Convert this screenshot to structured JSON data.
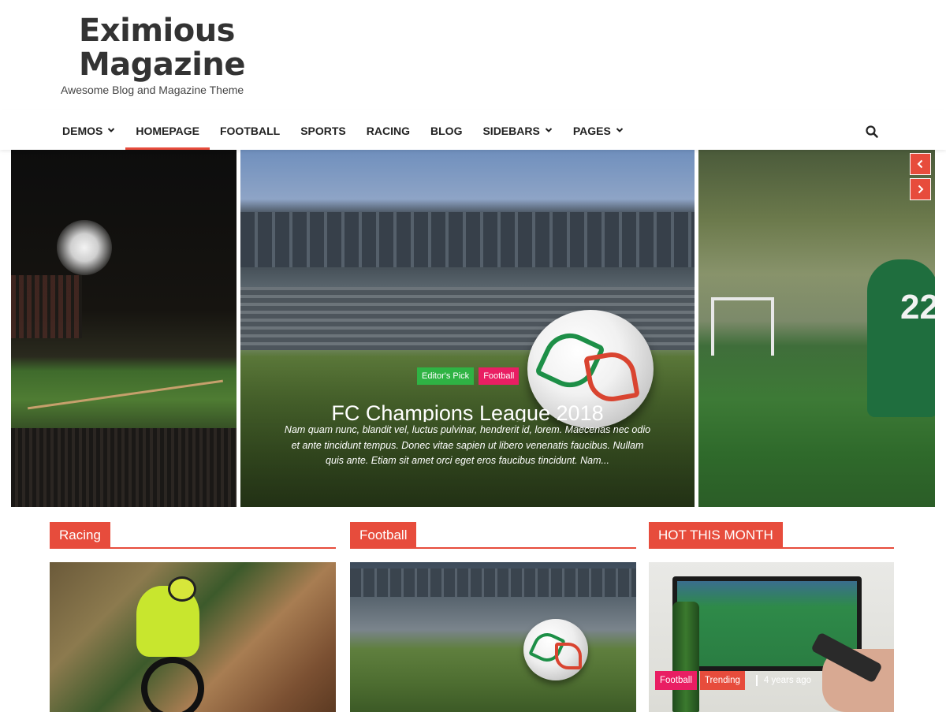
{
  "site": {
    "title": "Eximious Magazine",
    "tagline": "Awesome Blog and Magazine Theme"
  },
  "nav": {
    "items": [
      {
        "label": "DEMOS",
        "has_dropdown": true
      },
      {
        "label": "HOMEPAGE",
        "active": true
      },
      {
        "label": "FOOTBALL"
      },
      {
        "label": "SPORTS"
      },
      {
        "label": "RACING"
      },
      {
        "label": "BLOG"
      },
      {
        "label": "SIDEBARS",
        "has_dropdown": true
      },
      {
        "label": "PAGES",
        "has_dropdown": true
      }
    ],
    "search_icon": "search-icon"
  },
  "slider": {
    "featured": {
      "tags": [
        "Editor's Pick",
        "Football"
      ],
      "title": "FC Champions League 2018",
      "excerpt": "Nam quam nunc, blandit vel, luctus pulvinar, hendrerit id, lorem. Maecenas nec odio et ante tincidunt tempus. Donec vitae sapien ut libero venenatis faucibus. Nullam quis ante. Etiam sit amet orci eget eros faucibus tincidunt. Nam..."
    },
    "prev_arrow": "‹",
    "next_arrow": "›"
  },
  "sections": {
    "racing": {
      "label": "Racing"
    },
    "football": {
      "label": "Football"
    },
    "hot": {
      "label": "HOT THIS MONTH",
      "card": {
        "tags": [
          "Football",
          "Trending"
        ],
        "date": "4 years ago"
      }
    }
  },
  "colors": {
    "accent": "#e74c3c",
    "tag_green": "#2fb344",
    "tag_pink": "#e91e63"
  }
}
